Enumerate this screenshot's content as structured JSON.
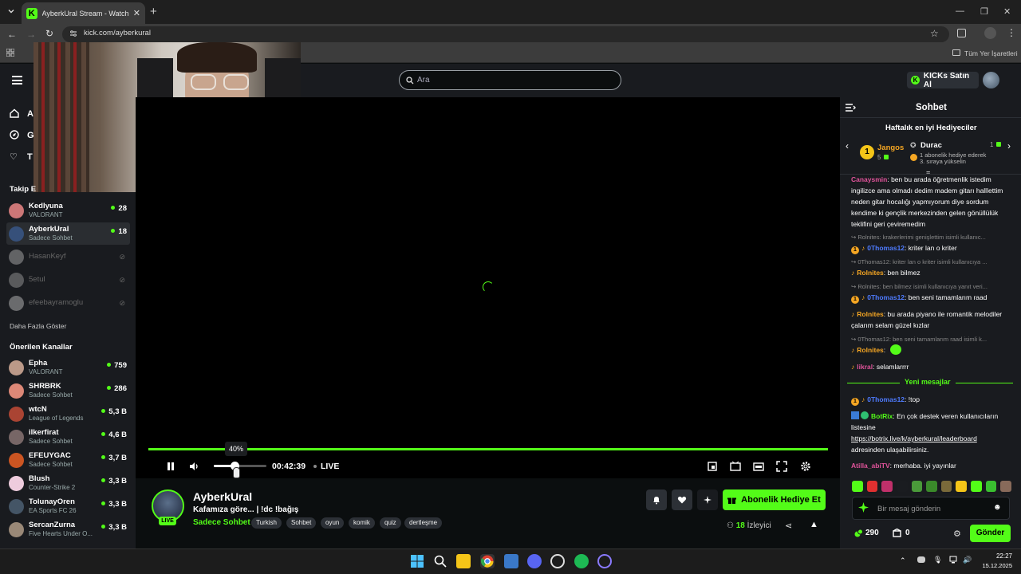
{
  "browser": {
    "tab_title": "AyberkUral Stream - Watch Live",
    "url": "kick.com/ayberkural",
    "bookmarks_label": "Tüm Yer İşaretleri"
  },
  "header": {
    "search_placeholder": "Ara",
    "kicks_button": "KICKs Satın Al"
  },
  "sidebar": {
    "nav": [
      {
        "label": "A"
      },
      {
        "label": "G"
      },
      {
        "label": "T"
      }
    ],
    "following_title": "Takip E",
    "following": [
      {
        "name": "Kedlyuna",
        "category": "VALORANT",
        "viewers": "28"
      },
      {
        "name": "AyberkUral",
        "category": "Sadece Sohbet",
        "viewers": "18"
      },
      {
        "name": "HasanKeyf"
      },
      {
        "name": "5etul"
      },
      {
        "name": "efeebayramoglu"
      }
    ],
    "show_more": "Daha Fazla Göster",
    "recommended_title": "Önerilen Kanallar",
    "recommended": [
      {
        "name": "Epha",
        "category": "VALORANT",
        "viewers": "759"
      },
      {
        "name": "SHRBRK",
        "category": "Sadece Sohbet",
        "viewers": "286"
      },
      {
        "name": "wtcN",
        "category": "League of Legends",
        "viewers": "5,3 B"
      },
      {
        "name": "ilkerfirat",
        "category": "Sadece Sohbet",
        "viewers": "4,6 B"
      },
      {
        "name": "EFEUYGAC",
        "category": "Sadece Sohbet",
        "viewers": "3,7 B"
      },
      {
        "name": "Blush",
        "category": "Counter-Strike 2",
        "viewers": "3,3 B"
      },
      {
        "name": "TolunayOren",
        "category": "EA Sports FC 26",
        "viewers": "3,3 B"
      },
      {
        "name": "SercanZurna",
        "category": "Five Hearts Under O...",
        "viewers": "3,3 B"
      }
    ]
  },
  "player": {
    "volume_label": "40%",
    "volume_level": 0.4,
    "time": "00:42:39",
    "live": "LIVE"
  },
  "stream": {
    "streamer": "AyberkUral",
    "live_badge": "LIVE",
    "title": "Kafamıza göre... | !dc !bağış",
    "category": "Sadece Sohbet",
    "tags": [
      "Turkish",
      "Sohbet",
      "oyun",
      "komik",
      "quiz",
      "dertleşme"
    ],
    "gift_sub_button": "Abonelik Hediye Et",
    "viewers_count": "18",
    "viewers_label": "İzleyici"
  },
  "chat": {
    "title": "Sohbet",
    "gifters_title": "Haftalık en iyi Hediyeciler",
    "gifter1_name": "Jangos",
    "gifter1_count": "5",
    "gifter1_rank": "1",
    "gifter2_name": "Durac",
    "gifter2_count": "1",
    "gifter2_note1": "1 abonelik hediye ederek",
    "gifter2_note2": "3. sıraya yükselin",
    "msg0_text": "ingilizce ama olmadı dedim madem gitarı halllettim neden gitar hocalığı yapmıyorum diye sordum kendime ki gençlik merkezinden gelen gönüllülük teklifini geri çeviremedim",
    "msg0_user": "Canaysmin",
    "msg0_first": ": ben bu arada öğretmenlik istedim",
    "reply1": "↪ Rolnites: krakerlerimi genişlettim isimli kullanıc...",
    "msg1_user": "0Thomas12",
    "msg1_text": ": kriter lan o kriter",
    "reply2": "↪ 0Thomas12: kriter lan o kriter isimli kullanıcıya ...",
    "msg2_user": "Rolnites",
    "msg2_text": ": ben bilmez",
    "reply3": "↪ Rolnites: ben bilmez isimli kullanıcıya yanıt veri...",
    "msg3_user": "0Thomas12",
    "msg3_text": ": ben seni tamamlarım raad",
    "msg4_user": "Rolnites",
    "msg4_text": ": bu arada piyano ile romantik melodiler çalarım selam güzel kızlar",
    "reply5": "↪ 0Thomas12: ben seni tamamlarım raad isimli k...",
    "msg5_user": "Rolnites",
    "msg5_text": ":",
    "msg6_user": "likral",
    "msg6_text": ": selamlarrrr",
    "new_messages": "Yeni mesajlar",
    "msg7_user": "0Thomas12",
    "msg7_text": ": !top",
    "msg8_user": "BotRix",
    "msg8_text": ": En çok destek veren kullanıcıların listesine",
    "msg8_link": "https://botrix.live/k/ayberkural/leaderboard",
    "msg8_tail": "adresinden ulaşabilirsiniz.",
    "msg9_user": "Atilla_abiTV",
    "msg9_text": ": merhaba. iyi yayınlar",
    "input_placeholder": "Bir mesaj gönderin",
    "kicks": "290",
    "subs": "0",
    "send_button": "Gönder"
  },
  "taskbar": {
    "time": "22:27",
    "date": "15.12.2025"
  },
  "colors": {
    "accent": "#53fc18",
    "background": "#0b0e0f",
    "panel": "#191b1f"
  }
}
